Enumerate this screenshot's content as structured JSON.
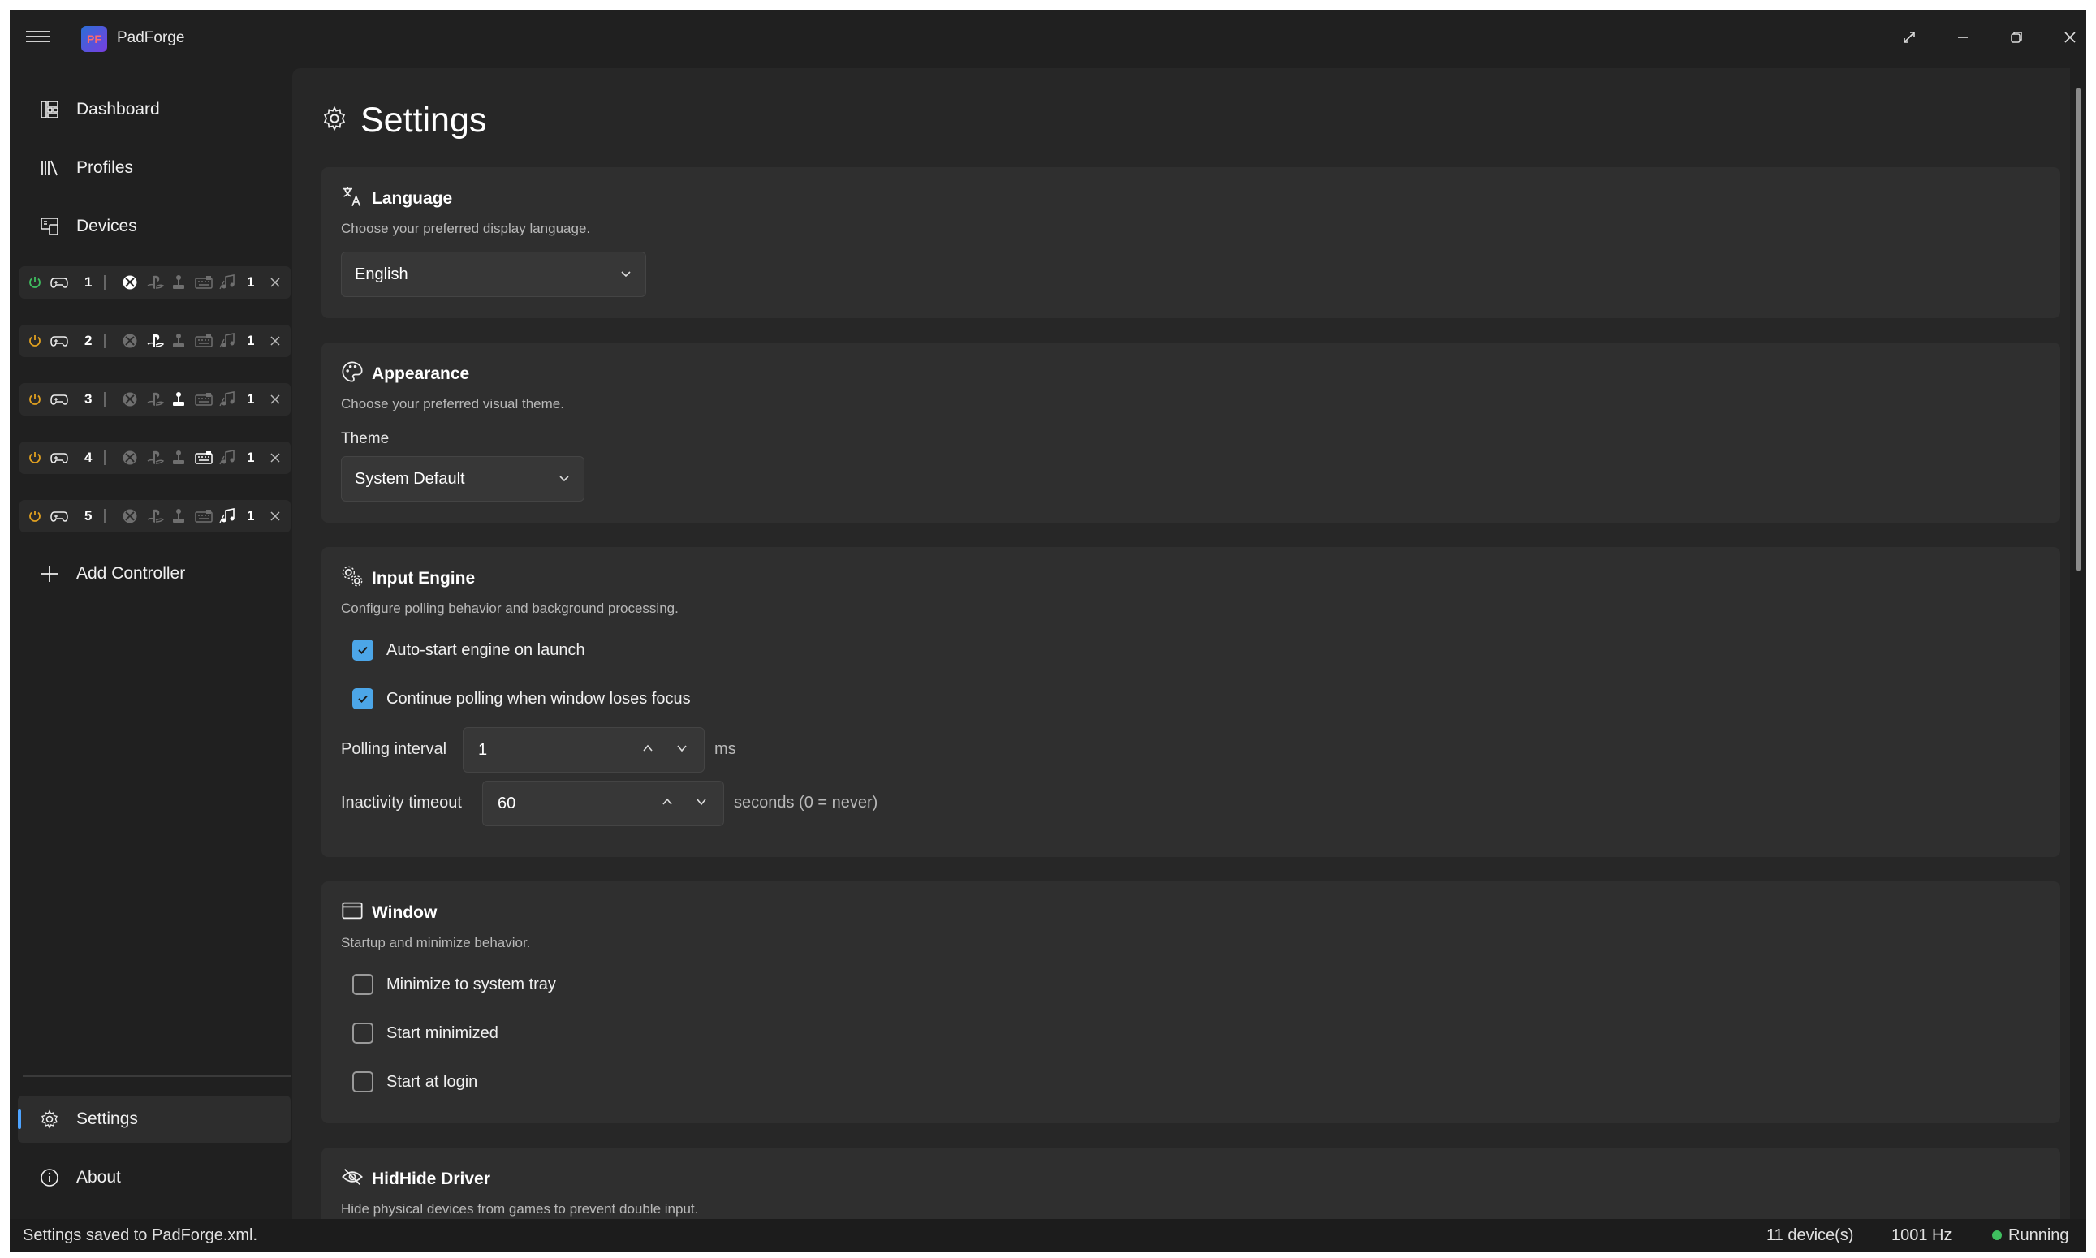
{
  "app": {
    "title": "PadForge",
    "logo_text": "PF"
  },
  "sidebar": {
    "nav": [
      {
        "label": "Dashboard",
        "icon": "dashboard-icon"
      },
      {
        "label": "Profiles",
        "icon": "library-icon"
      },
      {
        "label": "Devices",
        "icon": "devices-icon"
      }
    ],
    "controllers": [
      {
        "slot": "1",
        "count": "1",
        "active_type": "xbox"
      },
      {
        "slot": "2",
        "count": "1",
        "active_type": "playstation"
      },
      {
        "slot": "3",
        "count": "1",
        "active_type": "joystick"
      },
      {
        "slot": "4",
        "count": "1",
        "active_type": "keyboard"
      },
      {
        "slot": "5",
        "count": "1",
        "active_type": "midi"
      }
    ],
    "add_controller": "Add Controller",
    "footer": [
      {
        "label": "Settings",
        "icon": "gear-icon",
        "active": true
      },
      {
        "label": "About",
        "icon": "info-icon"
      }
    ]
  },
  "page": {
    "title": "Settings"
  },
  "sections": {
    "language": {
      "title": "Language",
      "desc": "Choose your preferred display language.",
      "value": "English"
    },
    "appearance": {
      "title": "Appearance",
      "desc": "Choose your preferred visual theme.",
      "theme_label": "Theme",
      "theme_value": "System Default"
    },
    "input_engine": {
      "title": "Input Engine",
      "desc": "Configure polling behavior and background processing.",
      "checks": [
        {
          "label": "Auto-start engine on launch",
          "checked": true
        },
        {
          "label": "Continue polling when window loses focus",
          "checked": true
        }
      ],
      "polling_label": "Polling interval",
      "polling_value": "1",
      "polling_unit": "ms",
      "inactivity_label": "Inactivity timeout",
      "inactivity_value": "60",
      "inactivity_unit": "seconds (0 = never)"
    },
    "window": {
      "title": "Window",
      "desc": "Startup and minimize behavior.",
      "checks": [
        {
          "label": "Minimize to system tray",
          "checked": false
        },
        {
          "label": "Start minimized",
          "checked": false
        },
        {
          "label": "Start at login",
          "checked": false
        }
      ]
    },
    "hidhide": {
      "title": "HidHide Driver",
      "desc": "Hide physical devices from games to prevent double input."
    }
  },
  "status": {
    "message": "Settings saved to PadForge.xml.",
    "devices": "11 device(s)",
    "rate": "1001 Hz",
    "state": "Running"
  },
  "colors": {
    "accent": "#4ca6e8",
    "running": "#3fbf5f",
    "power_on": "#3fbf5f",
    "power_warn": "#e0a020"
  }
}
